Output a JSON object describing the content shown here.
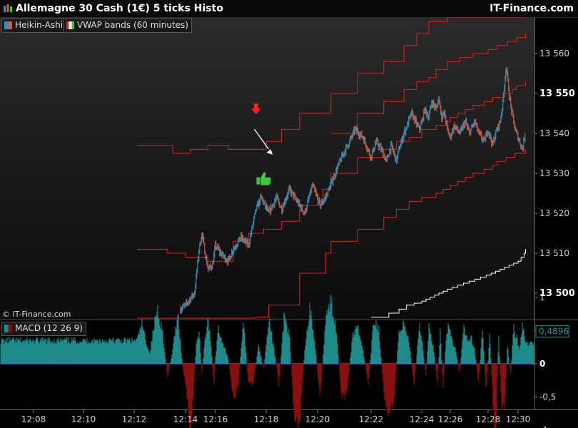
{
  "window": {
    "title": "Allemagne 30 Cash (1€) 5 ticks Histo",
    "brand": "IT-Finance.com",
    "copyright": "© IT-Finance.com"
  },
  "legend": {
    "price_series": "Heikin-Ashi",
    "indicator": "VWAP bands (60 minutes)",
    "macd": "MACD (12 26 9)"
  },
  "colors": {
    "background": "#000000",
    "ha_up": "#3a8fb7",
    "ha_down": "#c8624f",
    "band": "#e02020",
    "vwap_low": "#ffffff",
    "macd_pos": "#1f8a8a",
    "macd_neg": "#8a1010",
    "zero_line": "#2255cc",
    "signal_down_arrow": "#ff2020",
    "signal_thumb": "#3cc83c"
  },
  "chart_data": [
    {
      "type": "candlestick",
      "title": "Allemagne 30 Cash (1€) 5 ticks Histo",
      "x_ticks": [
        "12:08",
        "12:10",
        "12:12",
        "12:14",
        "12:16",
        "12:18",
        "12:20",
        "12:22",
        "12:24",
        "12:26",
        "12:28",
        "12:30"
      ],
      "y_ticks": [
        "13 500",
        "13 510",
        "13 520",
        "13 530",
        "13 540",
        "13 550",
        "13 560"
      ],
      "y_highlighted": [
        "13 500",
        "13 550"
      ],
      "ylim": [
        13497,
        13565
      ],
      "xlim": [
        12.1,
        30.5
      ],
      "price_path": {
        "t": [
          13.8,
          14.2,
          14.6,
          14.9,
          15.1,
          15.3,
          15.5,
          15.8,
          16.0,
          16.2,
          16.5,
          16.7,
          17.0,
          17.3,
          17.6,
          17.8,
          18.1,
          18.4,
          18.6,
          18.9,
          19.2,
          19.5,
          19.8,
          20.1,
          20.3,
          20.6,
          20.9,
          21.2,
          21.4,
          21.7,
          22.0,
          22.2,
          22.4,
          22.6,
          22.8,
          23.0,
          23.1,
          23.3,
          23.6,
          23.9,
          24.2,
          24.5,
          24.7,
          25.0,
          25.2,
          25.4,
          25.6,
          25.8,
          26.0,
          26.2,
          26.5,
          26.8,
          27.0,
          27.3,
          27.5,
          27.8,
          28.0,
          28.3,
          28.5,
          28.8,
          29.0,
          29.2,
          29.5,
          29.8,
          30.1,
          30.3,
          30.5
        ],
        "price": [
          13496,
          13498,
          13500,
          13511,
          13515,
          13510,
          13506,
          13507,
          13512,
          13510,
          13508,
          13511,
          13514,
          13512,
          13521,
          13524,
          13520,
          13524,
          13521,
          13526,
          13523,
          13520,
          13527,
          13522,
          13524,
          13529,
          13534,
          13538,
          13541,
          13539,
          13534,
          13538,
          13536,
          13533,
          13537,
          13533,
          13536,
          13540,
          13545,
          13541,
          13546,
          13544,
          13548,
          13546,
          13549,
          13544,
          13545,
          13541,
          13539,
          13542,
          13540,
          13543,
          13540,
          13543,
          13540,
          13538,
          13541,
          13537,
          13540,
          13543,
          13548,
          13557,
          13547,
          13541,
          13538,
          13536,
          13541
        ]
      },
      "vwap_bands": [
        {
          "name": "upper3",
          "t": [
            12.1,
            13.5,
            14.3,
            15.5,
            16.5,
            17.5,
            18.0,
            18.6,
            19.3,
            20.5,
            21.5,
            22.5,
            23.3,
            23.8,
            24.5,
            25.8,
            26.2,
            26.6,
            27.2,
            28.7,
            29.5,
            30.5
          ],
          "v": [
            13537,
            13535,
            13536,
            13537,
            13536,
            13536,
            13538,
            13541,
            13545,
            13550,
            13555,
            13558,
            13562,
            13565,
            13568,
            13573,
            13576,
            13579,
            13583,
            13586,
            13589,
            13592
          ]
        },
        {
          "name": "upper2",
          "t": [
            20.5,
            21.5,
            22.5,
            23.3,
            23.8,
            24.5,
            25.0,
            25.8,
            26.5,
            27.2,
            28.0,
            28.6,
            29.3,
            29.9,
            30.5
          ],
          "v": [
            13540,
            13545,
            13548,
            13551,
            13553,
            13554,
            13556,
            13558,
            13559,
            13560,
            13561,
            13562,
            13563,
            13564,
            13565
          ]
        },
        {
          "name": "upper1",
          "t": [
            12.1,
            13.3,
            14.0,
            15.5,
            16.7,
            17.3,
            17.9,
            18.6,
            19.3,
            20.2,
            20.5,
            21.5,
            22.5,
            23.0,
            23.5,
            24.0,
            25.0,
            25.8,
            26.0,
            26.4,
            26.8,
            27.2,
            27.8,
            28.3,
            29.0,
            29.6,
            29.9,
            30.5
          ],
          "v": [
            13511,
            13510,
            13509,
            13508,
            13513,
            13515,
            13516,
            13518,
            13522,
            13526,
            13530,
            13534,
            13536,
            13538,
            13539,
            13541,
            13542,
            13543,
            13544,
            13545,
            13546,
            13547,
            13548,
            13549,
            13550,
            13551,
            13552,
            13553
          ]
        },
        {
          "name": "lower1",
          "t": [
            12.1,
            13.9,
            14.5,
            15.2,
            15.8,
            16.6,
            17.2,
            17.6,
            18.1,
            19.3,
            20.3,
            20.5,
            21.5,
            22.5,
            23.0,
            23.5,
            24.0,
            25.0,
            25.5,
            26.0,
            26.4,
            26.8,
            27.2,
            27.8,
            28.3,
            28.6,
            29.2,
            29.8,
            30.5
          ],
          "v": [
            13480,
            13479,
            13480,
            13483,
            13486,
            13489,
            13492,
            13494,
            13497,
            13505,
            13510,
            13513,
            13516,
            13519,
            13521,
            13523,
            13524,
            13525,
            13526,
            13527,
            13528,
            13529,
            13530,
            13531,
            13532,
            13533,
            13534,
            13535,
            13536
          ]
        }
      ],
      "vwap_low_line": {
        "t": [
          22.0,
          22.7,
          23.1,
          23.4,
          23.7,
          24.0,
          24.3,
          24.6,
          24.9,
          25.2,
          25.5,
          25.8,
          26.1,
          26.4,
          26.7,
          27.0,
          27.3,
          27.6,
          27.9,
          28.2,
          28.5,
          28.8,
          29.1,
          29.4,
          29.7,
          30.0,
          30.2,
          30.4,
          30.5
        ],
        "v": [
          13494,
          13495,
          13496,
          13497,
          13497.5,
          13498,
          13498.5,
          13499,
          13499.5,
          13500,
          13500.5,
          13501,
          13501.5,
          13502,
          13502.5,
          13503,
          13503.5,
          13504,
          13504.5,
          13505,
          13505.5,
          13506,
          13506.5,
          13507,
          13507.5,
          13508,
          13509,
          13510,
          13511
        ]
      },
      "signals": [
        {
          "kind": "down-arrow",
          "t": 17.6,
          "price": 13543
        },
        {
          "kind": "diagonal-arrow",
          "t": 17.7,
          "price": 13540
        },
        {
          "kind": "thumbs-up",
          "t": 17.9,
          "price": 13529
        }
      ]
    },
    {
      "type": "bar",
      "title": "MACD (12 26 9)",
      "y_ticks": [
        "1",
        "0,5",
        "0",
        "-0,5",
        "-1"
      ],
      "ylim": [
        -1.3,
        1.1
      ],
      "current_value": "0,4896",
      "x_ticks": [
        "12:08",
        "12:10",
        "12:12",
        "12:14",
        "12:16",
        "12:18",
        "12:20",
        "12:22",
        "12:24",
        "12:26",
        "12:28",
        "12:30"
      ],
      "xlim": [
        12.1,
        30.5
      ],
      "profile": {
        "t": [
          12.1,
          12.3,
          12.6,
          12.9,
          13.1,
          13.3,
          13.5,
          13.7,
          13.9,
          14.1,
          14.3,
          14.5,
          14.7,
          14.9,
          15.1,
          15.3,
          15.5,
          15.7,
          15.9,
          16.1,
          16.3,
          16.5,
          16.7,
          16.9,
          17.1,
          17.3,
          17.5,
          17.7,
          17.9,
          18.1,
          18.3,
          18.5,
          18.7,
          18.9,
          19.1,
          19.3,
          19.5,
          19.7,
          19.9,
          20.1,
          20.3,
          20.5,
          20.7,
          20.9,
          21.1,
          21.3,
          21.5,
          21.7,
          21.9,
          22.1,
          22.3,
          22.5,
          22.7,
          22.9,
          23.1,
          23.3,
          23.5,
          23.7,
          23.9,
          24.1,
          24.3,
          24.5,
          24.7,
          24.9,
          25.1,
          25.3,
          25.5,
          25.7,
          25.9,
          26.1,
          26.3,
          26.5,
          26.7,
          26.9,
          27.1,
          27.3,
          27.5,
          27.7,
          27.9,
          28.1,
          28.3,
          28.5,
          28.7,
          28.9,
          29.1,
          29.3,
          29.5,
          29.7,
          29.9,
          30.1,
          30.3,
          30.5
        ],
        "v": [
          0.35,
          0.6,
          0.15,
          0.85,
          0.5,
          -0.2,
          0.2,
          0.8,
          -0.1,
          -0.5,
          -1.1,
          -0.6,
          0.25,
          0.5,
          -0.15,
          0.4,
          0.7,
          0.3,
          -0.35,
          0.55,
          0.3,
          0.1,
          -0.5,
          -0.35,
          0.7,
          -0.3,
          -0.3,
          0.3,
          -0.1,
          0.7,
          0.25,
          -0.3,
          0.75,
          0.45,
          -0.8,
          -0.9,
          0.2,
          0.85,
          0.3,
          -0.5,
          0.65,
          0.95,
          0.55,
          -0.55,
          -0.45,
          0.4,
          0.6,
          0.2,
          -0.3,
          0.65,
          0.55,
          -0.4,
          -0.8,
          -0.6,
          0.5,
          0.6,
          0.35,
          -0.35,
          0.6,
          0.2,
          -0.2,
          0.55,
          0.4,
          0.1,
          -0.3,
          0.5,
          -0.4,
          0.4,
          0.6,
          0.35,
          0.2,
          -0.15,
          0.6,
          0.35,
          0.4,
          0.2,
          -0.3,
          0.55,
          -0.4,
          0.5,
          -0.45,
          -1.3,
          0.5,
          -0.7,
          -0.65,
          0.3,
          -0.2,
          0.55,
          0.4,
          0.2,
          0.6,
          0.3
        ]
      }
    }
  ]
}
